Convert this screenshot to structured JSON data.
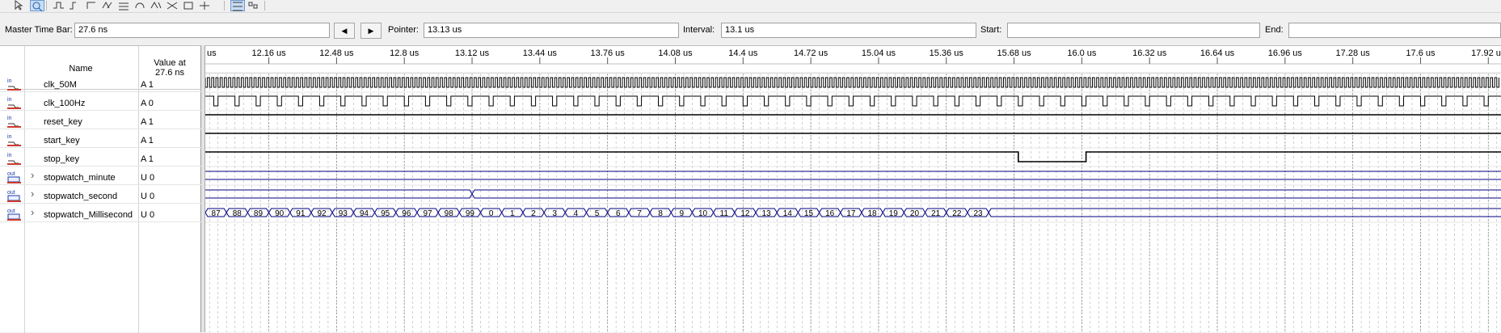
{
  "toolbar": {
    "icons": [
      "pointer-icon",
      "zoom-icon",
      "waveform-editor-icon",
      "force-low-icon",
      "force-high-icon",
      "invert-icon",
      "count-value-icon",
      "clock-icon",
      "arbitrary-value-icon",
      "random-value-icon",
      "snap-icon",
      "insert-icon",
      "grid-icon",
      "snap-grid-icon"
    ]
  },
  "controls": {
    "master_time_bar_label": "Master Time Bar:",
    "master_time_bar_value": "27.6 ns",
    "pointer_label": "Pointer:",
    "pointer_value": "13.13 us",
    "interval_label": "Interval:",
    "interval_value": "13.1 us",
    "start_label": "Start:",
    "start_value": "",
    "end_label": "End:",
    "end_value": "",
    "prev_icon": "triangle-left-icon",
    "next_icon": "triangle-right-icon"
  },
  "table": {
    "name_header": "Name",
    "value_header_line1": "Value at",
    "value_header_line2": "27.6 ns"
  },
  "signals": [
    {
      "dir": "in",
      "name": "clk_50M",
      "value": "A 1",
      "expandable": false
    },
    {
      "dir": "in",
      "name": "clk_100Hz",
      "value": "A 0",
      "expandable": false
    },
    {
      "dir": "in",
      "name": "reset_key",
      "value": "A 1",
      "expandable": false
    },
    {
      "dir": "in",
      "name": "start_key",
      "value": "A 1",
      "expandable": false
    },
    {
      "dir": "in",
      "name": "stop_key",
      "value": "A 1",
      "expandable": false
    },
    {
      "dir": "out",
      "name": "stopwatch_minute",
      "value": "U 0",
      "expandable": true
    },
    {
      "dir": "out",
      "name": "stopwatch_second",
      "value": "U 0",
      "expandable": true
    },
    {
      "dir": "out",
      "name": "stopwatch_Millisecond",
      "value": "U 0",
      "expandable": true
    }
  ],
  "timeline": {
    "first_partial_label": "us",
    "ticks": [
      "12.16 us",
      "12.48 us",
      "12.8 us",
      "13.12 us",
      "13.44 us",
      "13.76 us",
      "14.08 us",
      "14.4 us",
      "14.72 us",
      "15.04 us",
      "15.36 us",
      "15.68 us",
      "16.0 us",
      "16.32 us",
      "16.64 us",
      "16.96 us",
      "17.28 us",
      "17.6 us",
      "17.92 us"
    ],
    "tick_values_us": [
      12.16,
      12.48,
      12.8,
      13.12,
      13.44,
      13.76,
      14.08,
      14.4,
      14.72,
      15.04,
      15.36,
      15.68,
      16.0,
      16.32,
      16.64,
      16.96,
      17.28,
      17.6,
      17.92
    ]
  },
  "waves": {
    "view_start_us": 11.86,
    "view_end_us": 17.98,
    "clk_50M_period_us": 0.02,
    "clk_100Hz_period_us": 0.1,
    "clk_100Hz_low_us": 0.02,
    "stop_key_low_from_us": 15.7,
    "stop_key_low_to_us": 16.02,
    "second_transition_us": 13.12,
    "millisecond_values": [
      "87",
      "88",
      "89",
      "90",
      "91",
      "92",
      "93",
      "94",
      "95",
      "96",
      "97",
      "98",
      "99",
      "0",
      "1",
      "2",
      "3",
      "4",
      "5",
      "6",
      "7",
      "8",
      "9",
      "10",
      "11",
      "12",
      "13",
      "14",
      "15",
      "16",
      "17",
      "18",
      "19",
      "20",
      "21",
      "22",
      "23"
    ],
    "millisecond_first_start_us": 11.86,
    "millisecond_step_us": 0.1,
    "bus_color": "#000080",
    "signal_color": "#000000",
    "grid_color": "#b0b0b0"
  }
}
